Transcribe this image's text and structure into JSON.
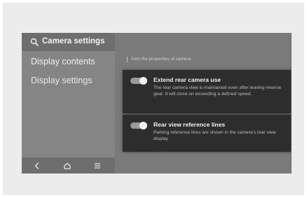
{
  "header": {
    "title": "Camera settings"
  },
  "sidebar": {
    "items": [
      {
        "label": "Display contents"
      },
      {
        "label": "Display settings"
      }
    ]
  },
  "main": {
    "description": "Sets the properties of camera.",
    "settings": [
      {
        "title": "Extend rear camera use",
        "description": "The rear camera view is maintained even after leaving reverse gear. It will close on exceeding a defined speed.",
        "enabled": true
      },
      {
        "title": "Rear view reference lines",
        "description": "Parking reference lines are shown in the camera's rear view display.",
        "enabled": true
      }
    ]
  },
  "nav": {
    "icons": [
      "back-icon",
      "home-icon",
      "menu-icon"
    ]
  },
  "colors": {
    "screen_bg": "#7a7a7a",
    "card_bg": "#2d2d2d",
    "toggle_on": "#f4f4f4"
  }
}
